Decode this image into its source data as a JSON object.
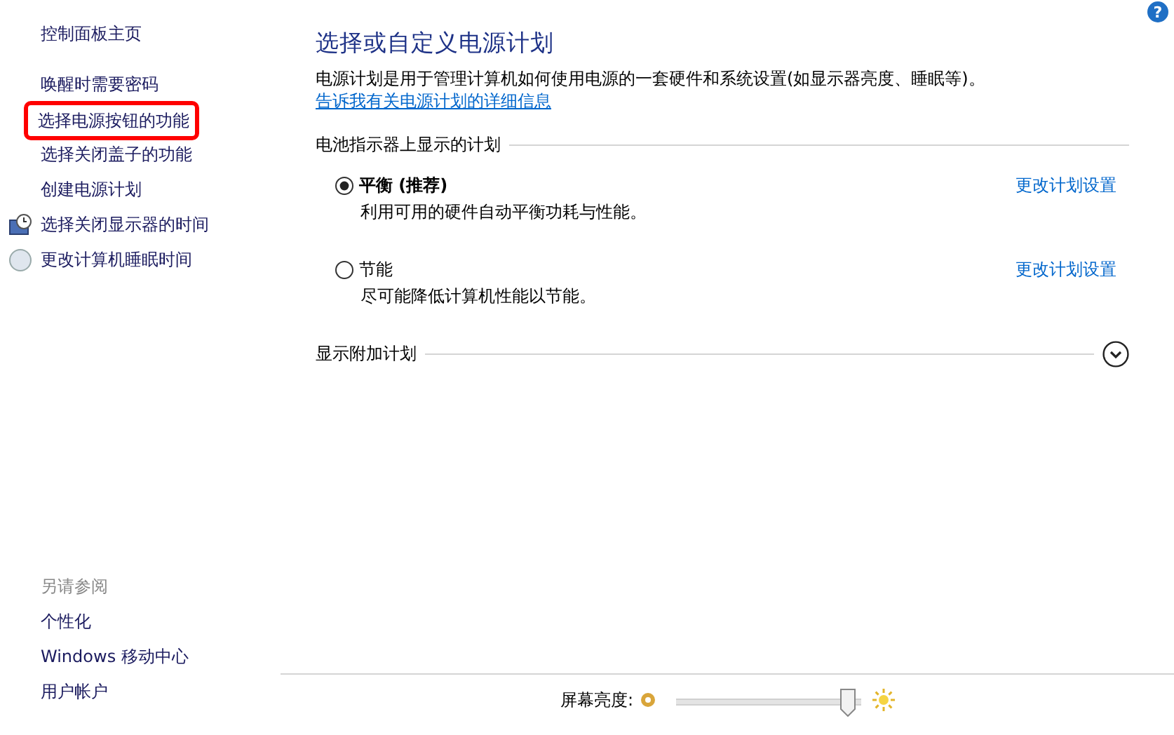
{
  "sidebar": {
    "home": "控制面板主页",
    "items": [
      {
        "label": "唤醒时需要密码",
        "kind": "plain",
        "highlighted": false
      },
      {
        "label": "选择电源按钮的功能",
        "kind": "plain",
        "highlighted": true
      },
      {
        "label": "选择关闭盖子的功能",
        "kind": "plain",
        "highlighted": false
      },
      {
        "label": "创建电源计划",
        "kind": "plain",
        "highlighted": false
      },
      {
        "label": "选择关闭显示器的时间",
        "kind": "monitor",
        "highlighted": false
      },
      {
        "label": "更改计算机睡眠时间",
        "kind": "sleep",
        "highlighted": false
      }
    ],
    "see_also": {
      "heading": "另请参阅",
      "links": [
        "个性化",
        "Windows 移动中心",
        "用户帐户"
      ]
    }
  },
  "main": {
    "help": "?",
    "title": "选择或自定义电源计划",
    "description": "电源计划是用于管理计算机如何使用电源的一套硬件和系统设置(如显示器亮度、睡眠等)。",
    "info_link": "告诉我有关电源计划的详细信息",
    "section": "电池指示器上显示的计划",
    "plans": [
      {
        "name": "平衡 (推荐)",
        "description": "利用可用的硬件自动平衡功耗与性能。",
        "selected": true,
        "link": "更改计划设置"
      },
      {
        "name": "节能",
        "description": "尽可能降低计算机性能以节能。",
        "selected": false,
        "link": "更改计划设置"
      }
    ],
    "additional": {
      "label": "显示附加计划",
      "expanded": false
    }
  },
  "brightness": {
    "label": "屏幕亮度:",
    "level": 0.97
  }
}
